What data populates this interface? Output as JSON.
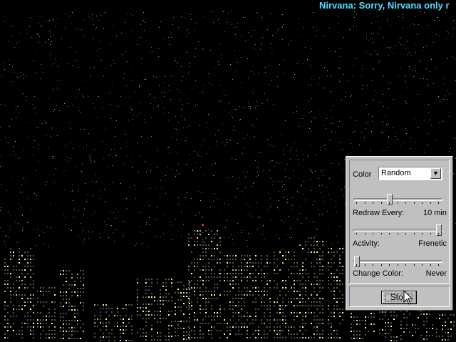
{
  "screen": {
    "marquee": "Nirvana: Sorry, Nirvana only r"
  },
  "panel": {
    "color_label": "Color",
    "color_value": "Random",
    "redraw_label": "Redraw Every:",
    "redraw_value": "10 min",
    "redraw_level": 0.4,
    "activity_label": "Activity:",
    "activity_value": "Frenetic",
    "activity_level": 1.0,
    "change_label": "Change Color:",
    "change_value": "Never",
    "change_level": 0.0,
    "stop_label": "Stop"
  },
  "icons": {
    "dropdown": "chevron-down-icon",
    "cursor": "arrow-cursor-icon"
  },
  "colors": {
    "background": "#000000",
    "marquee": "#4ee0ff",
    "window_light": "#ffff80",
    "panel": "#c0c0c0"
  }
}
